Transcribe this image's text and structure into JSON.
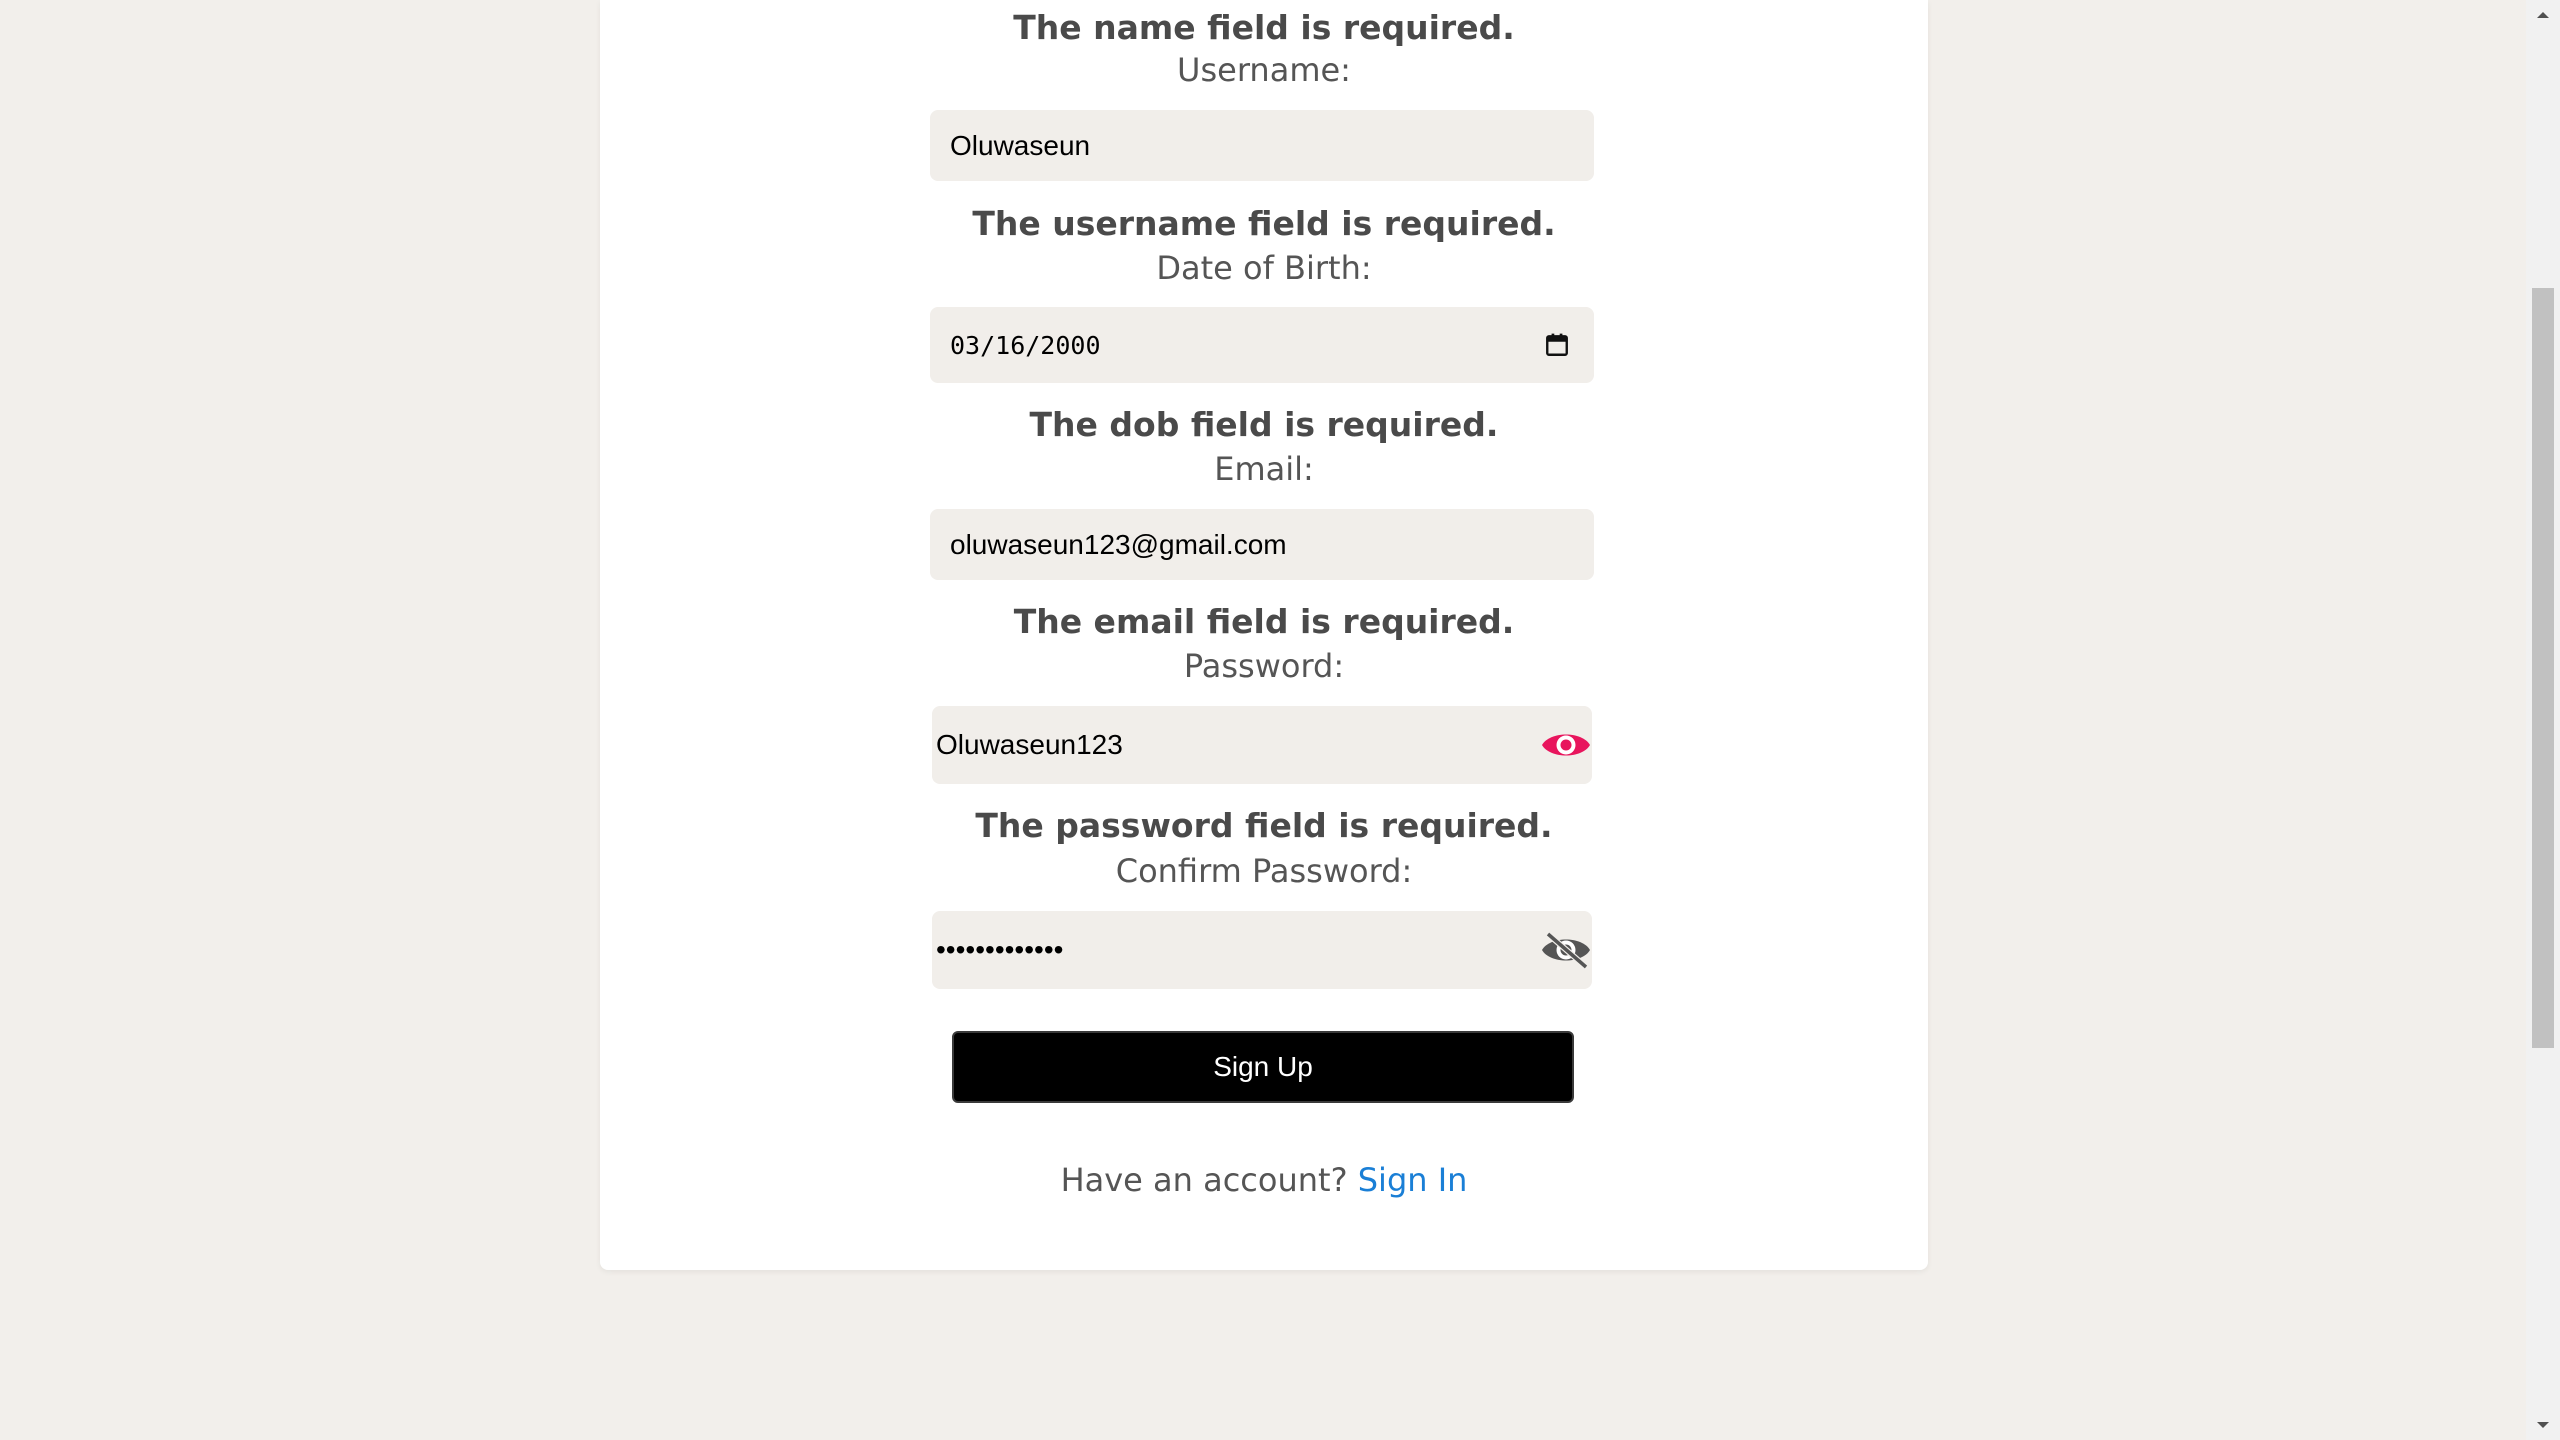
{
  "form": {
    "errors": {
      "name": "The name field is required.",
      "username": "The username field is required.",
      "dob": "The dob field is required.",
      "email": "The email field is required.",
      "password": "The password field is required."
    },
    "labels": {
      "username": "Username:",
      "dob": "Date of Birth:",
      "email": "Email:",
      "password": "Password:",
      "confirm_password": "Confirm Password:"
    },
    "values": {
      "username": "Oluwaseun",
      "dob": "03/16/2000",
      "email": "oluwaseun123@gmail.com",
      "password": "Oluwaseun123",
      "confirm_password": "•••••••••••••"
    },
    "signup_label": "Sign Up",
    "account_prompt": "Have an account?",
    "signin_label": "Sign In"
  },
  "colors": {
    "background": "#f2efeb",
    "field_bg": "#f1eeea",
    "eye_visible": "#e8155d",
    "eye_hidden": "#555555",
    "link": "#1a7fd6",
    "button_bg": "#000000"
  },
  "icons": {
    "password_toggle": "eye-icon",
    "confirm_password_toggle": "eye-off-icon",
    "date_picker": "calendar-icon"
  }
}
